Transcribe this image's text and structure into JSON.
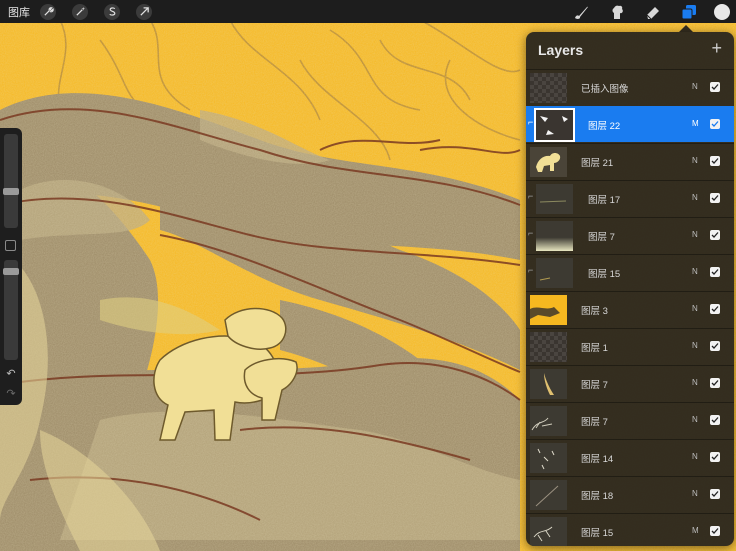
{
  "toolbar": {
    "gallery_label": "图库",
    "left_tools": [
      "wrench-icon",
      "magic-wand-icon",
      "selection-icon",
      "transform-arrow-icon"
    ],
    "right_tools": [
      "brush-icon",
      "smudge-icon",
      "eraser-icon",
      "layers-icon"
    ],
    "active_tool": "layers-icon",
    "active_color": "#1a7cf0"
  },
  "layers_panel": {
    "title": "Layers",
    "add_label": "+",
    "layers": [
      {
        "name": "已插入图像",
        "blend": "N",
        "visible": true,
        "selected": false,
        "clipped": false
      },
      {
        "name": "图层 22",
        "blend": "M",
        "visible": true,
        "selected": true,
        "clipped": true
      },
      {
        "name": "图层 21",
        "blend": "N",
        "visible": true,
        "selected": false,
        "clipped": false
      },
      {
        "name": "图层 17",
        "blend": "N",
        "visible": true,
        "selected": false,
        "clipped": true
      },
      {
        "name": "图层 7",
        "blend": "N",
        "visible": true,
        "selected": false,
        "clipped": true
      },
      {
        "name": "图层 15",
        "blend": "N",
        "visible": true,
        "selected": false,
        "clipped": true
      },
      {
        "name": "图层 3",
        "blend": "N",
        "visible": true,
        "selected": false,
        "clipped": false
      },
      {
        "name": "图层 1",
        "blend": "N",
        "visible": true,
        "selected": false,
        "clipped": false
      },
      {
        "name": "图层 7",
        "blend": "N",
        "visible": true,
        "selected": false,
        "clipped": false
      },
      {
        "name": "图层 7",
        "blend": "N",
        "visible": true,
        "selected": false,
        "clipped": false
      },
      {
        "name": "图层 14",
        "blend": "N",
        "visible": true,
        "selected": false,
        "clipped": false
      },
      {
        "name": "图层 18",
        "blend": "N",
        "visible": true,
        "selected": false,
        "clipped": false
      },
      {
        "name": "图层 15",
        "blend": "M",
        "visible": true,
        "selected": false,
        "clipped": false
      }
    ]
  },
  "sidebar": {
    "brush_size_level": 0.55,
    "opacity_level": 0.85,
    "undo_icon": "undo-icon",
    "redo_icon": "redo-icon"
  },
  "colors": {
    "canvas_background": "#f6b820",
    "selection_blue": "#1a7cf0",
    "current_color": "#e8e8e8"
  }
}
